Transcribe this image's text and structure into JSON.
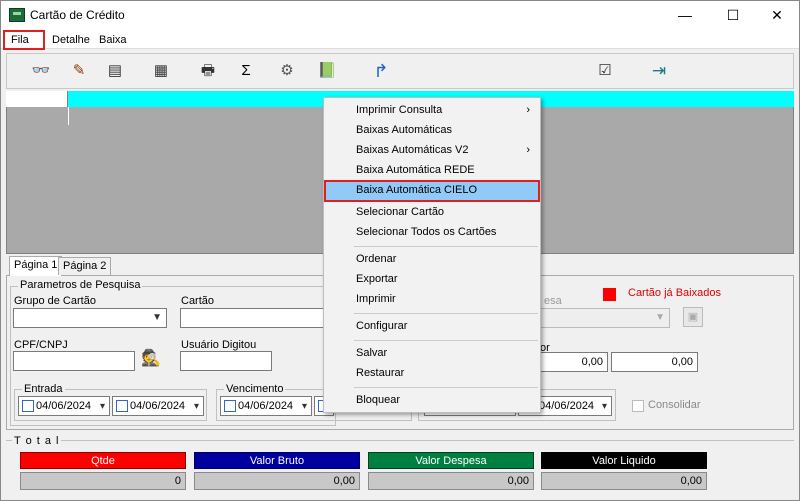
{
  "window": {
    "title": "Cartão de Crédito",
    "minimize": "—",
    "maximize": "☐",
    "close": "✕"
  },
  "menubar": {
    "items": [
      "Fila",
      "Detalhe",
      "Baixa"
    ]
  },
  "toolbar": {
    "icons": [
      "glasses-icon",
      "pen-icon",
      "form-icon",
      "list-icon",
      "printer-icon",
      "sigma-icon",
      "tools-icon",
      "book-icon",
      "arrow-icon",
      "checklist-icon",
      "exit-icon"
    ],
    "glyphs": [
      "👓",
      "✎",
      "▤",
      "▦",
      "🖶",
      "Σ",
      "⚙",
      "📗",
      "↱",
      "☑",
      "⇥"
    ]
  },
  "tabs": [
    "Página 1",
    "Página 2"
  ],
  "form": {
    "group_title": "Parametros de Pesquisa",
    "grupo_label": "Grupo de Cartão",
    "cartao_label": "Cartão",
    "cpf_label": "CPF/CNPJ",
    "usuario_label": "Usuário Digitou",
    "despesa_label_partial": "esa",
    "valor_label_partial": "or",
    "legend_text": "Cartão já Baixados",
    "legend_color": "#ff0000",
    "entrada_label": "Entrada",
    "vencimento_label": "Vencimento",
    "date1": "04/06/2024",
    "date2": "04/06/2024",
    "date3": "04/06/2024",
    "date5": "04/06/2024",
    "valor_min": "0,00",
    "valor_max": "0,00",
    "consolidar_label": "Consolidar"
  },
  "totals": {
    "title": "T o t a l",
    "items": [
      {
        "label": "Qtde",
        "value": "0",
        "color": "#ff0000"
      },
      {
        "label": "Valor Bruto",
        "value": "0,00",
        "color": "#0000a0"
      },
      {
        "label": "Valor Despesa",
        "value": "0,00",
        "color": "#008040"
      },
      {
        "label": "Valor Liquido",
        "value": "0,00",
        "color": "#000000"
      }
    ]
  },
  "context_menu": {
    "items": [
      {
        "label": "Imprimir Consulta",
        "submenu": "›"
      },
      {
        "label": "Baixas Automáticas",
        "submenu": ""
      },
      {
        "label": "Baixas Automáticas V2",
        "submenu": "›"
      },
      {
        "label": "Baixa Automática REDE",
        "submenu": ""
      },
      {
        "label": "Baixa Automática CIELO",
        "submenu": "",
        "selected": true
      },
      {
        "label": "Selecionar Cartão",
        "submenu": ""
      },
      {
        "label": "Selecionar Todos os Cartões",
        "submenu": ""
      },
      {
        "label": "Ordenar",
        "submenu": ""
      },
      {
        "label": "Exportar",
        "submenu": ""
      },
      {
        "label": "Imprimir",
        "submenu": ""
      },
      {
        "label": "Configurar",
        "submenu": ""
      },
      {
        "label": "Salvar",
        "submenu": ""
      },
      {
        "label": "Restaurar",
        "submenu": ""
      },
      {
        "label": "Bloquear",
        "submenu": ""
      }
    ]
  }
}
